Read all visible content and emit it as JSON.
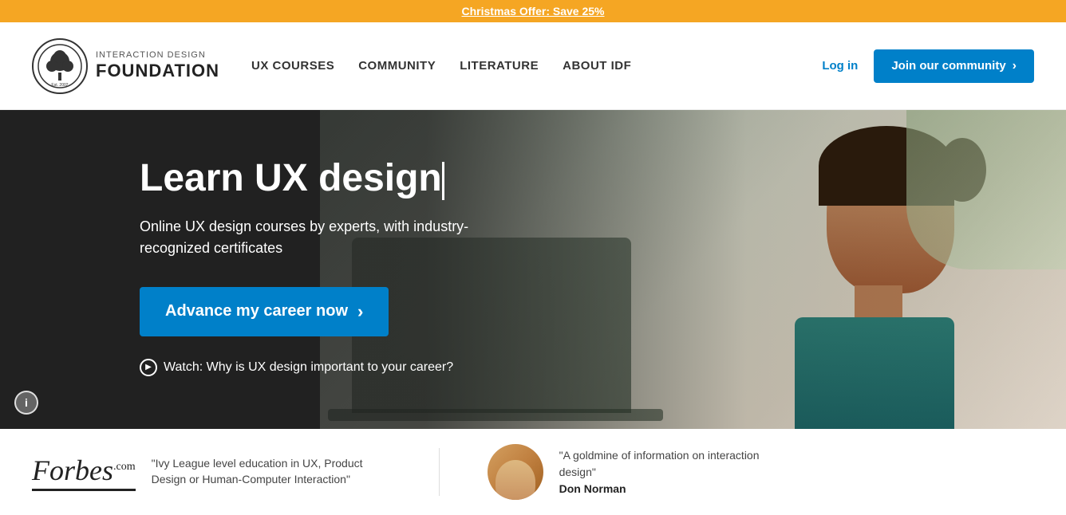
{
  "banner": {
    "text": "Christmas Offer: Save 25%",
    "bg_color": "#f5a623"
  },
  "header": {
    "logo": {
      "top_text": "INTERACTION DESIGN",
      "bottom_text": "FOUNDATION",
      "est": "Est. 2002"
    },
    "nav": [
      {
        "label": "UX COURSES",
        "id": "ux-courses"
      },
      {
        "label": "COMMUNITY",
        "id": "community"
      },
      {
        "label": "LITERATURE",
        "id": "literature"
      },
      {
        "label": "ABOUT IDF",
        "id": "about-idf"
      }
    ],
    "login_label": "Log in",
    "join_label": "Join our community",
    "join_chevron": "›"
  },
  "hero": {
    "title": "Learn UX design",
    "subtitle": "Online UX design courses by experts, with industry-recognized certificates",
    "cta_label": "Advance my career now",
    "cta_arrow": "›",
    "watch_text": "Watch: Why is UX design important to your career?"
  },
  "social_proof": {
    "forbes": {
      "logo": "Forbes",
      "com": ".com",
      "quote": "\"Ivy League level education in UX, Product Design or Human-Computer Interaction\""
    },
    "don_norman": {
      "quote": "\"A goldmine of information on interaction design\"",
      "name": "Don Norman"
    }
  }
}
